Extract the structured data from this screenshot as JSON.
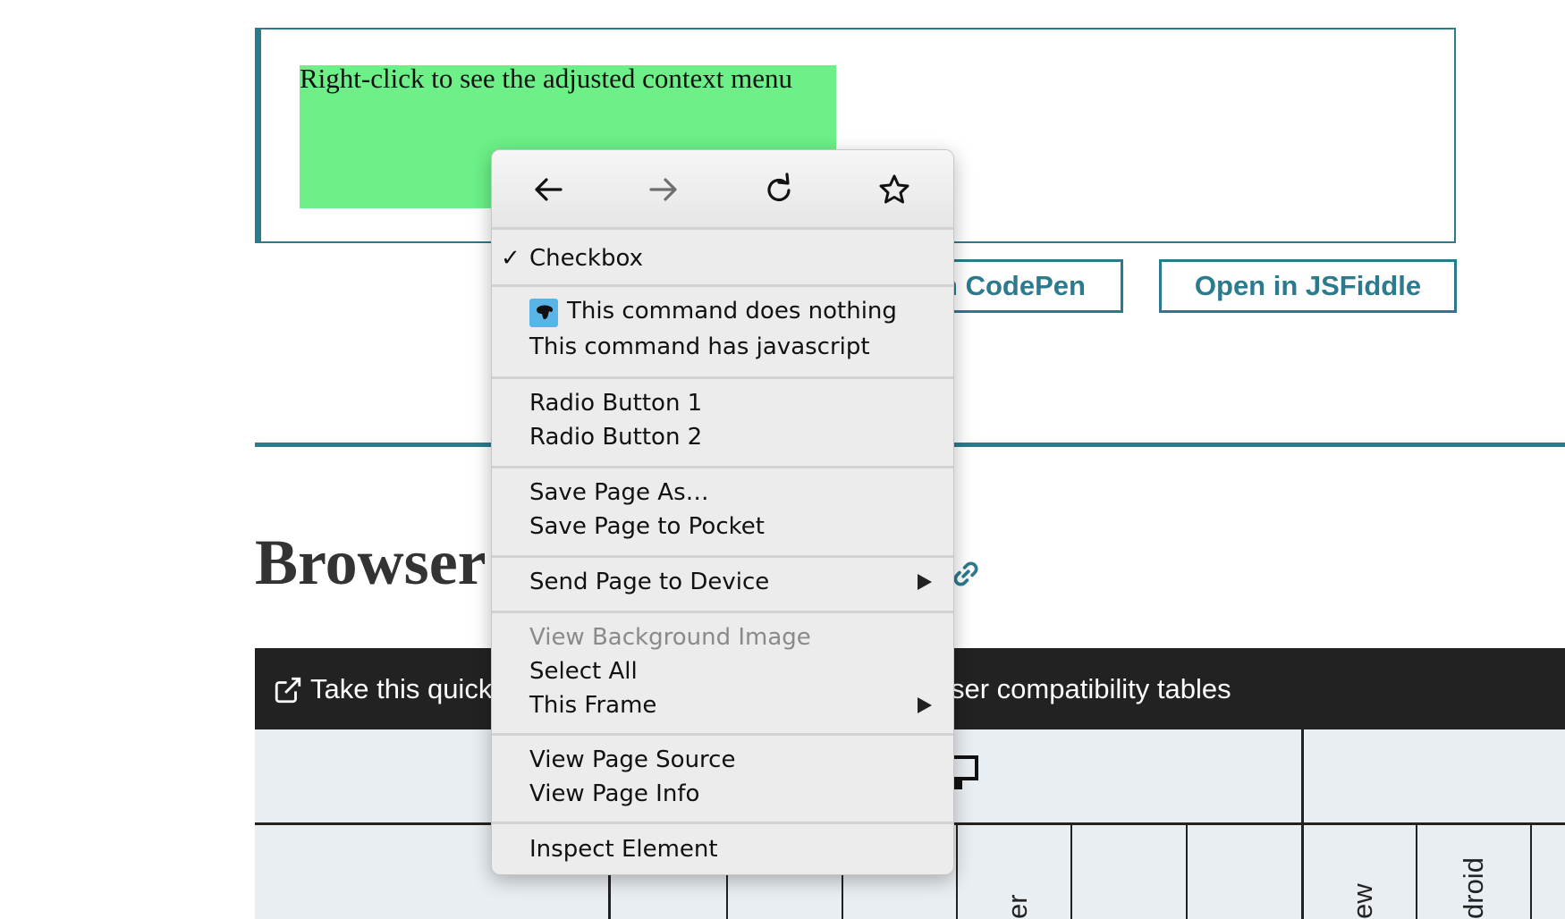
{
  "demo": {
    "instruction": "Right-click to see the adjusted context menu",
    "open_codepen_label": "n CodePen",
    "open_jsfiddle_label": "Open in JSFiddle"
  },
  "heading": {
    "title": "Browser"
  },
  "survey_bar": {
    "text_left": "Take this quick",
    "text_right": "ser compatibility tables"
  },
  "table": {
    "rotated_labels": [
      "er",
      "ew",
      "droid"
    ]
  },
  "context_menu": {
    "nav": {
      "back": "back-icon",
      "forward": "forward-icon",
      "reload": "reload-icon",
      "bookmark": "star-icon"
    },
    "checkbox": {
      "label": "Checkbox",
      "checked": true
    },
    "command_nothing": "This command does nothing",
    "command_javascript": "This command has javascript",
    "radio_1": "Radio Button 1",
    "radio_2": "Radio Button 2",
    "save_page_as": "Save Page As…",
    "save_to_pocket": "Save Page to Pocket",
    "send_to_device": "Send Page to Device",
    "view_background_image": "View Background Image",
    "select_all": "Select All",
    "this_frame": "This Frame",
    "view_page_source": "View Page Source",
    "view_page_info": "View Page Info",
    "inspect_element": "Inspect Element"
  },
  "colors": {
    "accent": "#2b7a8e",
    "green_area": "#6cf087",
    "survey_bar": "#222222",
    "table_bg": "#e9eef2"
  }
}
